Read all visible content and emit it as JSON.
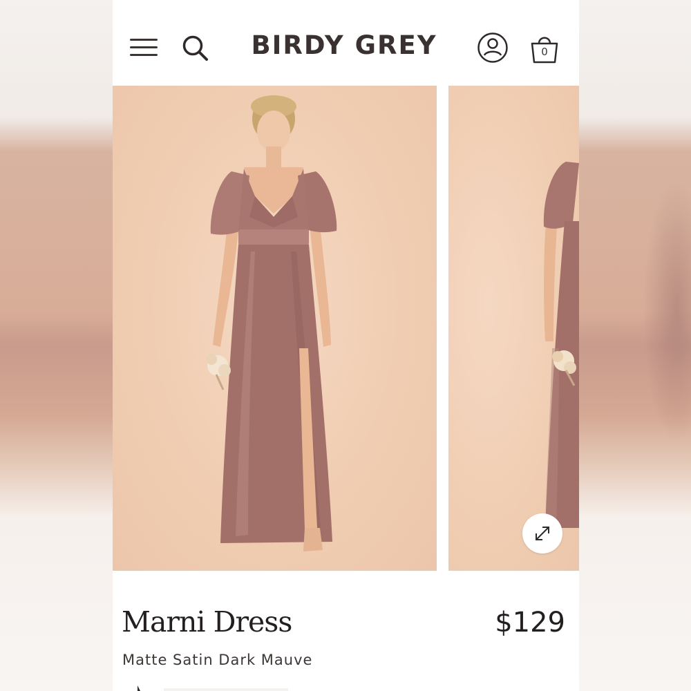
{
  "header": {
    "brand": "BIRDY GREY",
    "bag_count": "0",
    "icons": [
      "menu-icon",
      "search-icon",
      "account-icon",
      "shopping-bag-icon"
    ]
  },
  "gallery": {
    "images": [
      "dress-front-image",
      "dress-side-image"
    ],
    "expand_icon": "expand-icon"
  },
  "product": {
    "name": "Marni Dress",
    "price": "$129",
    "color": "Matte Satin Dark Mauve"
  },
  "colors": {
    "dress": "#a36f69",
    "background_photo": "#f0cdb2",
    "text": "#231f1e"
  }
}
